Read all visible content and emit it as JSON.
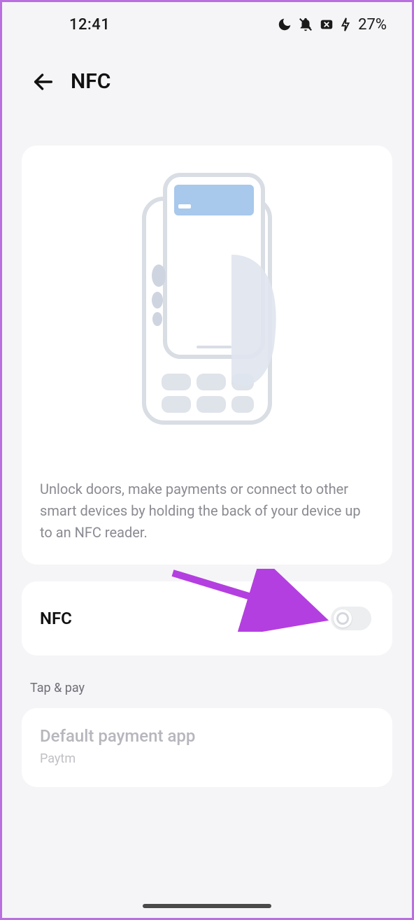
{
  "status": {
    "time": "12:41",
    "battery_pct": "27%"
  },
  "header": {
    "title": "NFC"
  },
  "intro": {
    "description": "Unlock doors, make payments or connect to other smart devices by holding the back of your device up to an NFC reader."
  },
  "nfc_toggle": {
    "label": "NFC",
    "enabled": false
  },
  "tap_pay": {
    "section_label": "Tap & pay",
    "default_app_label": "Default payment app",
    "default_app_value": "Paytm"
  }
}
